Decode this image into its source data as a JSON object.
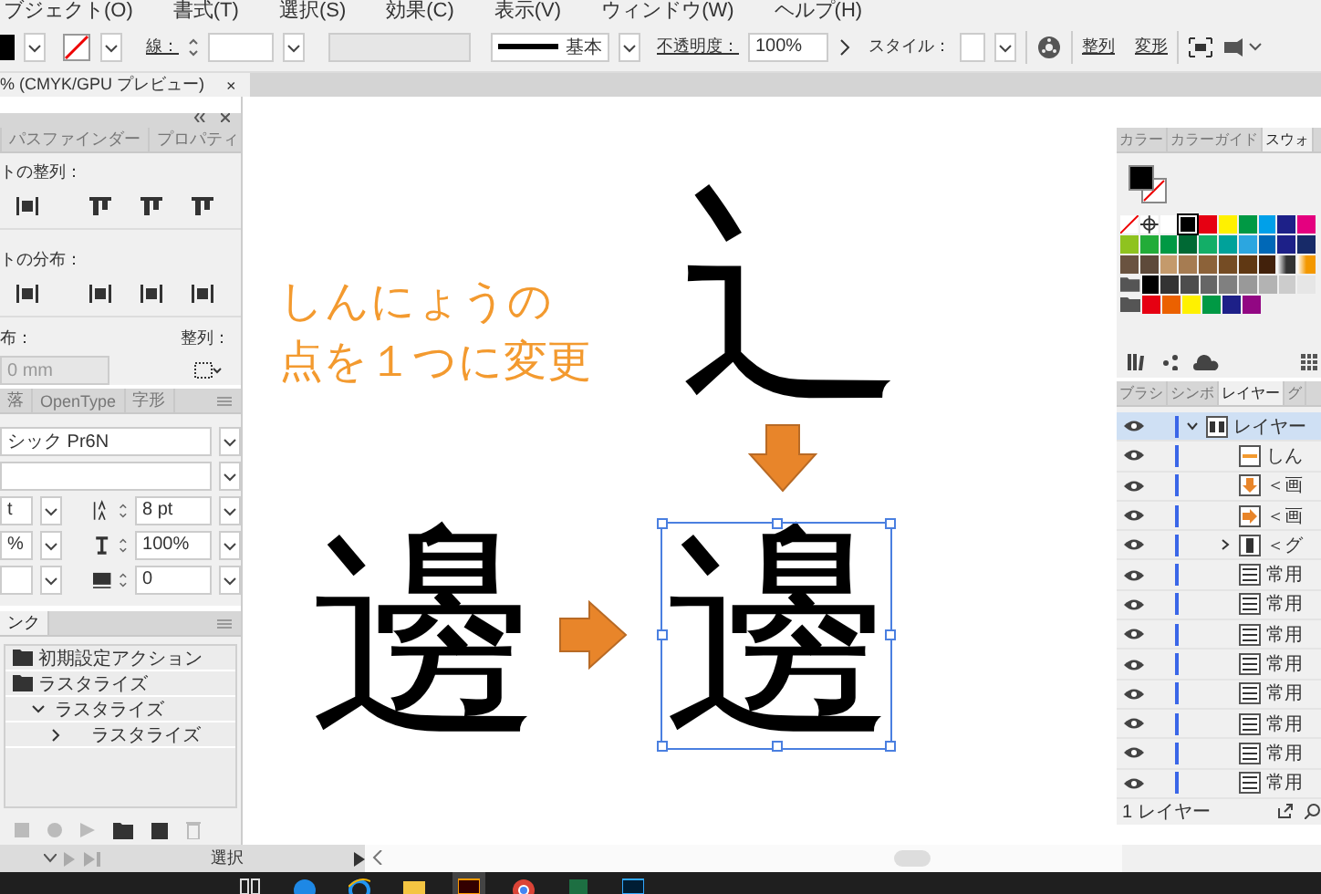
{
  "menu_bar": {
    "items": [
      "ブジェクト(O)",
      "書式(T)",
      "選択(S)",
      "効果(C)",
      "表示(V)",
      "ウィンドウ(W)",
      "ヘルプ(H)"
    ]
  },
  "control_bar": {
    "stroke_label": "線：",
    "stroke_profile": "基本",
    "opacity_label": "不透明度：",
    "opacity": "100%",
    "style_label": "スタイル：",
    "align_link": "整列",
    "transform_link": "変形"
  },
  "document_tab": {
    "title": "% (CMYK/GPU プレビュー)",
    "close": "×"
  },
  "align_panel": {
    "tabs": [
      {
        "label": "パスファインダー",
        "selected": false
      },
      {
        "label": "プロパティ",
        "selected": false
      }
    ],
    "align_label": "トの整列：",
    "distribute_label": "トの分布：",
    "spacing_label": "布：",
    "spacing_value": "0 mm",
    "align_to_label": "整列："
  },
  "character_panel": {
    "tabs": [
      {
        "label": "落",
        "selected": false
      },
      {
        "label": "OpenType",
        "selected": false
      },
      {
        "label": "字形",
        "selected": false
      }
    ],
    "font_family": "シック Pr6N",
    "font_size": "t",
    "horizontal_scale": "%",
    "leading": "8 pt",
    "vertical_scale": "100%",
    "tracking": "0"
  },
  "actions_panel": {
    "tab": "ンク",
    "items": [
      {
        "label": "初期設定アクション",
        "kind": "set",
        "selected": false
      },
      {
        "label": "ラスタライズ",
        "kind": "set",
        "selected": false,
        "children": [
          {
            "label": "ラスタライズ",
            "expanded": true,
            "selected": false,
            "children": [
              {
                "label": "ラスタライズ",
                "expanded": false,
                "selected": false
              }
            ]
          }
        ]
      }
    ]
  },
  "canvas": {
    "note_lines": [
      "しんにょうの",
      "点を１つに変更"
    ],
    "radical": "辶",
    "glyph_before": "邊",
    "glyph_after": "邊",
    "glyph_after_selected": true
  },
  "color_panel": {
    "tabs": [
      {
        "label": "カラー",
        "selected": false
      },
      {
        "label": "カラーガイド",
        "selected": false
      },
      {
        "label": "スウォ",
        "selected": true
      }
    ],
    "swatch_rows": [
      {
        "group": false,
        "swatches": [
          {
            "kind": "none",
            "selected": false
          },
          {
            "kind": "registration",
            "selected": false
          },
          {
            "kind": "color",
            "color": "#ffffff",
            "selected": false
          },
          {
            "kind": "color",
            "color": "#000000",
            "selected": true
          },
          {
            "kind": "color",
            "color": "#e60012",
            "selected": false
          },
          {
            "kind": "color",
            "color": "#fff100",
            "selected": false
          },
          {
            "kind": "color",
            "color": "#009944",
            "selected": false
          },
          {
            "kind": "color",
            "color": "#00a0e9",
            "selected": false
          },
          {
            "kind": "color",
            "color": "#1d2088",
            "selected": false
          },
          {
            "kind": "color",
            "color": "#e4007f",
            "selected": false
          }
        ]
      },
      {
        "group": false,
        "swatches": [
          {
            "kind": "color",
            "color": "#8fc31f",
            "selected": false
          },
          {
            "kind": "color",
            "color": "#22ac38",
            "selected": false
          },
          {
            "kind": "color",
            "color": "#009944",
            "selected": false
          },
          {
            "kind": "color",
            "color": "#006934",
            "selected": false
          },
          {
            "kind": "color",
            "color": "#13ae67",
            "selected": false
          },
          {
            "kind": "color",
            "color": "#00a29a",
            "selected": false
          },
          {
            "kind": "color",
            "color": "#2ca6e0",
            "selected": false
          },
          {
            "kind": "color",
            "color": "#0068b7",
            "selected": false
          },
          {
            "kind": "color",
            "color": "#1d2088",
            "selected": false
          },
          {
            "kind": "color",
            "color": "#172a68",
            "selected": false
          }
        ]
      },
      {
        "group": false,
        "swatches": [
          {
            "kind": "color",
            "color": "#6a5340",
            "selected": false
          },
          {
            "kind": "color",
            "color": "#5e4a3a",
            "selected": false
          },
          {
            "kind": "color",
            "color": "#c49a6c",
            "selected": false
          },
          {
            "kind": "color",
            "color": "#a67c52",
            "selected": false
          },
          {
            "kind": "color",
            "color": "#8c6239",
            "selected": false
          },
          {
            "kind": "color",
            "color": "#754c24",
            "selected": false
          },
          {
            "kind": "color",
            "color": "#603813",
            "selected": false
          },
          {
            "kind": "color",
            "color": "#42210b",
            "selected": false
          },
          {
            "kind": "gradient",
            "color": "#333333",
            "selected": false
          },
          {
            "kind": "gradient",
            "color": "#f39800",
            "selected": false
          }
        ]
      },
      {
        "group": true,
        "swatches": [
          {
            "kind": "color",
            "color": "#000000",
            "selected": false
          },
          {
            "kind": "color",
            "color": "#333333",
            "selected": false
          },
          {
            "kind": "color",
            "color": "#4d4d4d",
            "selected": false
          },
          {
            "kind": "color",
            "color": "#666666",
            "selected": false
          },
          {
            "kind": "color",
            "color": "#808080",
            "selected": false
          },
          {
            "kind": "color",
            "color": "#999999",
            "selected": false
          },
          {
            "kind": "color",
            "color": "#b3b3b3",
            "selected": false
          },
          {
            "kind": "color",
            "color": "#cccccc",
            "selected": false
          },
          {
            "kind": "color",
            "color": "#e6e6e6",
            "selected": false
          }
        ]
      },
      {
        "group": true,
        "swatches": [
          {
            "kind": "color",
            "color": "#e60012",
            "selected": false
          },
          {
            "kind": "color",
            "color": "#eb6100",
            "selected": false
          },
          {
            "kind": "color",
            "color": "#fff100",
            "selected": false
          },
          {
            "kind": "color",
            "color": "#009944",
            "selected": false
          },
          {
            "kind": "color",
            "color": "#1d2088",
            "selected": false
          },
          {
            "kind": "color",
            "color": "#920783",
            "selected": false
          }
        ]
      }
    ]
  },
  "layers_panel": {
    "tabs": [
      {
        "label": "ブラシ",
        "selected": false
      },
      {
        "label": "シンボ",
        "selected": false
      },
      {
        "label": "レイヤー",
        "selected": true
      },
      {
        "label": "グ",
        "selected": false
      }
    ],
    "layers": [
      {
        "name": "レイヤー",
        "kind": "layer",
        "visible": true,
        "selected": true,
        "expanded": true,
        "children": [
          {
            "name": "しん",
            "kind": "text",
            "visible": true,
            "selected": false
          },
          {
            "name": "＜画",
            "kind": "arrow_down",
            "visible": true,
            "selected": false
          },
          {
            "name": "＜画",
            "kind": "arrow_right",
            "visible": true,
            "selected": false
          },
          {
            "name": "＜グ",
            "kind": "group",
            "visible": true,
            "selected": false,
            "expanded": false
          },
          {
            "name": "常用",
            "kind": "glyph",
            "visible": true,
            "selected": false
          },
          {
            "name": "常用",
            "kind": "glyph",
            "visible": true,
            "selected": false
          },
          {
            "name": "常用",
            "kind": "glyph",
            "visible": true,
            "selected": false
          },
          {
            "name": "常用",
            "kind": "glyph",
            "visible": true,
            "selected": false
          },
          {
            "name": "常用",
            "kind": "glyph",
            "visible": true,
            "selected": false
          },
          {
            "name": "常用",
            "kind": "glyph",
            "visible": true,
            "selected": false
          },
          {
            "name": "常用",
            "kind": "glyph",
            "visible": true,
            "selected": false
          },
          {
            "name": "常用",
            "kind": "glyph",
            "visible": true,
            "selected": false
          }
        ]
      }
    ],
    "count": "1 レイヤー"
  },
  "status_bar": {
    "tool": "選択"
  },
  "taskbar": {
    "apps": [
      {
        "kind": "task_view",
        "selected": false
      },
      {
        "kind": "edge",
        "selected": false
      },
      {
        "kind": "ie",
        "selected": false
      },
      {
        "kind": "files",
        "selected": false
      },
      {
        "kind": "illustrator",
        "selected": true
      },
      {
        "kind": "chrome",
        "selected": false
      },
      {
        "kind": "excel",
        "selected": false
      },
      {
        "kind": "photoshop",
        "selected": false
      }
    ]
  }
}
